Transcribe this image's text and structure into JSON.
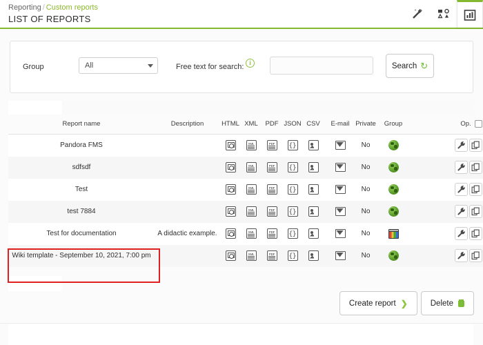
{
  "header": {
    "breadcrumb_main": "Reporting",
    "breadcrumb_sep": "/",
    "breadcrumb_current": "Custom reports",
    "title": "LIST OF REPORTS",
    "icons": [
      {
        "name": "magic-wand-icon",
        "glyph": "wand"
      },
      {
        "name": "shapes-icon",
        "glyph": "shapes"
      },
      {
        "name": "report-view-icon",
        "glyph": "report",
        "active": true
      }
    ]
  },
  "filter": {
    "group_label": "Group",
    "group_value": "All",
    "group_options": [
      "All"
    ],
    "freetext_label": "Free text for search:",
    "info_glyph": "i",
    "search_value": "",
    "search_placeholder": "",
    "search_button": "Search"
  },
  "table": {
    "columns": {
      "name": "Report name",
      "description": "Description",
      "html": "HTML",
      "xml": "XML",
      "pdf": "PDF",
      "json": "JSON",
      "csv": "CSV",
      "email": "E-mail",
      "private": "Private",
      "group": "Group",
      "op": "Op."
    },
    "rows": [
      {
        "name": "Pandora FMS",
        "description": "",
        "private": "No",
        "group_icon": "globe-icon"
      },
      {
        "name": "sdfsdf",
        "description": "",
        "private": "No",
        "group_icon": "globe-icon"
      },
      {
        "name": "Test",
        "description": "",
        "private": "No",
        "group_icon": "globe-icon"
      },
      {
        "name": "test 7884",
        "description": "",
        "private": "No",
        "group_icon": "globe-icon"
      },
      {
        "name": "Test for documentation",
        "description": "A didactic example.",
        "private": "No",
        "group_icon": "grid-icon"
      },
      {
        "name": "Wiki template - September 10, 2021, 7:00 pm",
        "description": "",
        "private": "No",
        "group_icon": "globe-icon"
      }
    ]
  },
  "footer": {
    "create_label": "Create report",
    "delete_label": "Delete"
  },
  "colors": {
    "accent_green": "#82b92e",
    "highlight_red": "#e02020",
    "link_green": "#8cb82b"
  }
}
